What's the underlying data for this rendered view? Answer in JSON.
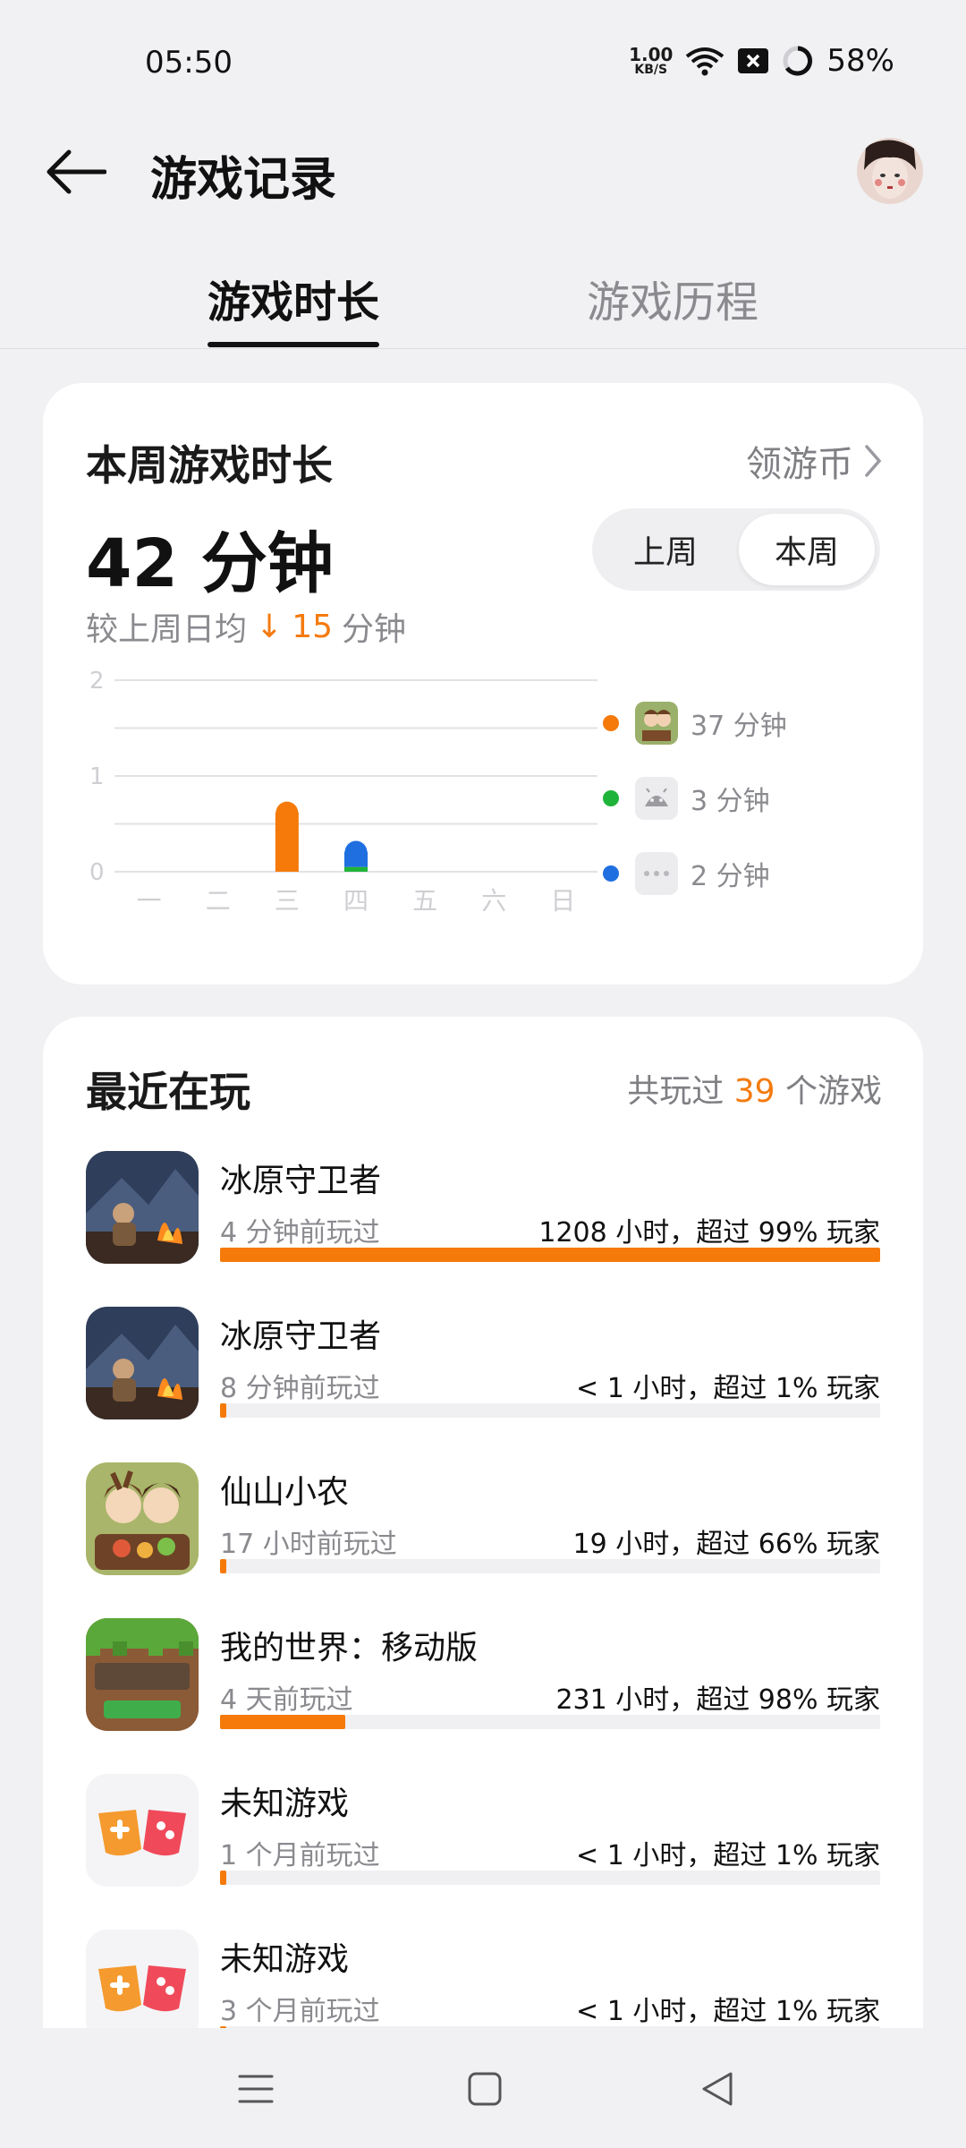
{
  "status_bar": {
    "time": "05:50",
    "net_speed_value": "1.00",
    "net_speed_unit": "KB/S",
    "battery": "58%"
  },
  "header": {
    "title": "游戏记录"
  },
  "tabs": [
    {
      "label": "游戏时长",
      "active": true
    },
    {
      "label": "游戏历程",
      "active": false
    }
  ],
  "week_card": {
    "title": "本周游戏时长",
    "coin_link": "领游币",
    "total": "42 分钟",
    "compare_prefix": "较上周日均",
    "compare_arrow": "↓",
    "compare_value": "15",
    "compare_unit": "分钟",
    "segment": {
      "last_week": "上周",
      "this_week": "本周",
      "selected": "本周"
    }
  },
  "chart_data": {
    "type": "bar",
    "stacked": true,
    "categories": [
      "一",
      "二",
      "三",
      "四",
      "五",
      "六",
      "日"
    ],
    "ylim": [
      0,
      2
    ],
    "yticks": [
      "0",
      "1",
      "2"
    ],
    "grid": true,
    "series": [
      {
        "color": "#f57a0a",
        "values": [
          0,
          0,
          0.62,
          0,
          0,
          0,
          0
        ]
      },
      {
        "color": "#1fb33a",
        "values": [
          0,
          0,
          0,
          0.05,
          0,
          0,
          0
        ]
      },
      {
        "color": "#1f6fe0",
        "values": [
          0,
          0,
          0,
          0.16,
          0,
          0,
          0
        ]
      }
    ],
    "legend": [
      {
        "color": "#f57a0a",
        "icon": "game-icon",
        "label": "37 分钟"
      },
      {
        "color": "#1fb33a",
        "icon": "android-icon",
        "label": "3 分钟"
      },
      {
        "color": "#1f6fe0",
        "icon": "more-icon",
        "label": "2 分钟"
      }
    ]
  },
  "recent": {
    "title": "最近在玩",
    "count_prefix": "共玩过",
    "count_value": "39",
    "count_suffix": "个游戏",
    "games": [
      {
        "name": "冰原守卫者",
        "last_played": "4 分钟前玩过",
        "stat": "1208 小时，超过 99% 玩家",
        "progress": 1.0,
        "icon": "campfire"
      },
      {
        "name": "冰原守卫者",
        "last_played": "8 分钟前玩过",
        "stat": "< 1 小时，超过 1% 玩家",
        "progress": 0.01,
        "icon": "campfire"
      },
      {
        "name": "仙山小农",
        "last_played": "17 小时前玩过",
        "stat": "19 小时，超过 66% 玩家",
        "progress": 0.01,
        "icon": "farm"
      },
      {
        "name": "我的世界：移动版",
        "last_played": "4 天前玩过",
        "stat": "231 小时，超过 98% 玩家",
        "progress": 0.19,
        "icon": "minecraft"
      },
      {
        "name": "未知游戏",
        "last_played": "1 个月前玩过",
        "stat": "< 1 小时，超过 1% 玩家",
        "progress": 0.01,
        "icon": "gamepad"
      },
      {
        "name": "未知游戏",
        "last_played": "3 个月前玩过",
        "stat": "< 1 小时，超过 1% 玩家",
        "progress": 0.01,
        "icon": "gamepad"
      }
    ]
  },
  "colors": {
    "accent": "#f47b0f",
    "bar": "#f57a0a"
  }
}
